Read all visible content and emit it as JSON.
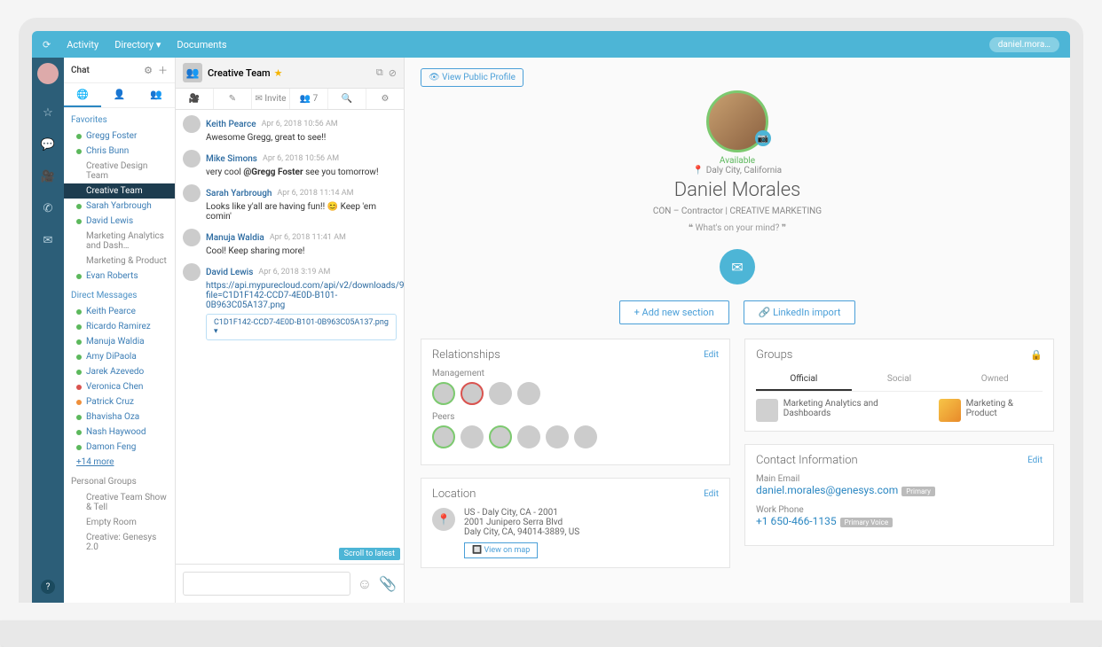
{
  "topbar": {
    "nav": [
      "Activity",
      "Directory ▾",
      "Documents"
    ],
    "user": "daniel.mora…"
  },
  "chat": {
    "title": "Chat",
    "sections": {
      "favorites": "Favorites",
      "dm": "Direct Messages",
      "more": "+14 more",
      "pg": "Personal Groups"
    },
    "fav": [
      {
        "dot": "d-green",
        "label": "Gregg Foster"
      },
      {
        "dot": "d-green",
        "label": "Chris Bunn"
      },
      {
        "dot": "d-none",
        "label": "Creative Design Team",
        "grey": true
      },
      {
        "dot": "d-none",
        "label": "Creative Team",
        "active": true
      },
      {
        "dot": "d-green",
        "label": "Sarah Yarbrough"
      },
      {
        "dot": "d-green",
        "label": "David Lewis"
      },
      {
        "dot": "d-none",
        "label": "Marketing Analytics and Dash…",
        "grey": true
      },
      {
        "dot": "d-none",
        "label": "Marketing & Product",
        "grey": true
      },
      {
        "dot": "d-green",
        "label": "Evan Roberts"
      }
    ],
    "dm": [
      {
        "dot": "d-green",
        "label": "Keith Pearce"
      },
      {
        "dot": "d-green",
        "label": "Ricardo Ramirez"
      },
      {
        "dot": "d-green",
        "label": "Manuja Waldia"
      },
      {
        "dot": "d-green",
        "label": "Amy DiPaola"
      },
      {
        "dot": "d-green",
        "label": "Jarek Azevedo"
      },
      {
        "dot": "d-red",
        "label": "Veronica Chen"
      },
      {
        "dot": "d-orange",
        "label": "Patrick Cruz"
      },
      {
        "dot": "d-green",
        "label": "Bhavisha Oza"
      },
      {
        "dot": "d-green",
        "label": "Nash Haywood"
      },
      {
        "dot": "d-green",
        "label": "Damon Feng"
      }
    ],
    "pg": [
      {
        "label": "Creative Team Show & Tell"
      },
      {
        "label": "Empty Room"
      },
      {
        "label": "Creative: Genesys 2.0"
      }
    ]
  },
  "conv": {
    "room": "Creative Team",
    "invite": "✉ Invite",
    "people": "👥 7",
    "msgs": [
      {
        "name": "Keith Pearce",
        "time": "Apr 6, 2018 10:56 AM",
        "body": "Awesome Gregg, great to see!!",
        "img": true
      },
      {
        "name": "Mike Simons",
        "time": "Apr 6, 2018 10:56 AM",
        "body": "very cool <b>@Gregg Foster</b> see you tomorrow!"
      },
      {
        "name": "Sarah Yarbrough",
        "time": "Apr 6, 2018 11:14 AM",
        "body": "Looks like y'all are having fun!! 😊 Keep 'em comin'"
      },
      {
        "name": "Manuja Waldia",
        "time": "Apr 6, 2018 11:41 AM",
        "body": "Cool! Keep sharing more!"
      },
      {
        "name": "David Lewis",
        "time": "Apr 6, 2018 3:19 AM",
        "link": "https://api.mypurecloud.com/api/v2/downloads/9bf06dce/?file=C1D1F142-CCD7-4E0D-B101-0B963C05A137.png",
        "file": "C1D1F142-CCD7-4E0D-B101-0B963C05A137.png ▾",
        "img2": true
      }
    ],
    "scroll": "Scroll to latest"
  },
  "profile": {
    "viewPublic": "👁 View Public Profile",
    "status": "Available",
    "loc": "📍 Daly City, California",
    "name": "Daniel Morales",
    "role1": "CON – Contractor",
    "roleSep": " | ",
    "role2": "CREATIVE MARKETING",
    "mind": "What's on your mind?",
    "addSection": "+ Add new section",
    "linkedin": "🔗 LinkedIn import",
    "rel": {
      "title": "Relationships",
      "edit": "Edit",
      "mgmt": "Management",
      "peers": "Peers"
    },
    "location": {
      "title": "Location",
      "edit": "Edit",
      "l1": "US - Daly City, CA - 2001",
      "l2": "2001 Junipero Serra Blvd",
      "l3": "Daly City, CA, 94014-3889, US",
      "map": "🔲 View on map"
    },
    "groups": {
      "title": "Groups",
      "tabs": [
        "Official",
        "Social",
        "Owned"
      ],
      "g1": "Marketing Analytics and Dashboards",
      "g2": "Marketing & Product"
    },
    "contact": {
      "title": "Contact Information",
      "edit": "Edit",
      "emailL": "Main Email",
      "email": "daniel.morales@genesys.com",
      "emailB": "Primary",
      "phoneL": "Work Phone",
      "phone": "+1 650-466-1135",
      "phoneB": "Primary Voice"
    }
  }
}
